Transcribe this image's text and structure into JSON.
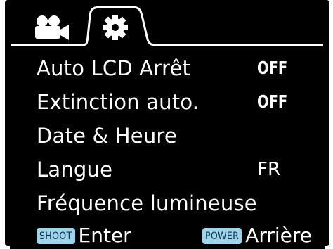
{
  "tabs": [
    {
      "icon": "camcorder-icon",
      "selected": false
    },
    {
      "icon": "gear-icon",
      "selected": true
    }
  ],
  "menu": {
    "items": [
      {
        "label": "Auto LCD Arrêt",
        "value": "OFF"
      },
      {
        "label": "Extinction auto.",
        "value": "OFF"
      },
      {
        "label": "Date & Heure",
        "value": ""
      },
      {
        "label": "Langue",
        "value": "FR"
      },
      {
        "label": "Fréquence lumineuse",
        "value": ""
      }
    ]
  },
  "footer": {
    "enter_key": "SHOOT",
    "enter_label": "Enter",
    "back_key": "POWER",
    "back_label": "Arrière"
  },
  "colors": {
    "background": "#000000",
    "text": "#ffffff",
    "key_badge": "#9fd3ea",
    "key_badge_text": "#0b3550"
  }
}
